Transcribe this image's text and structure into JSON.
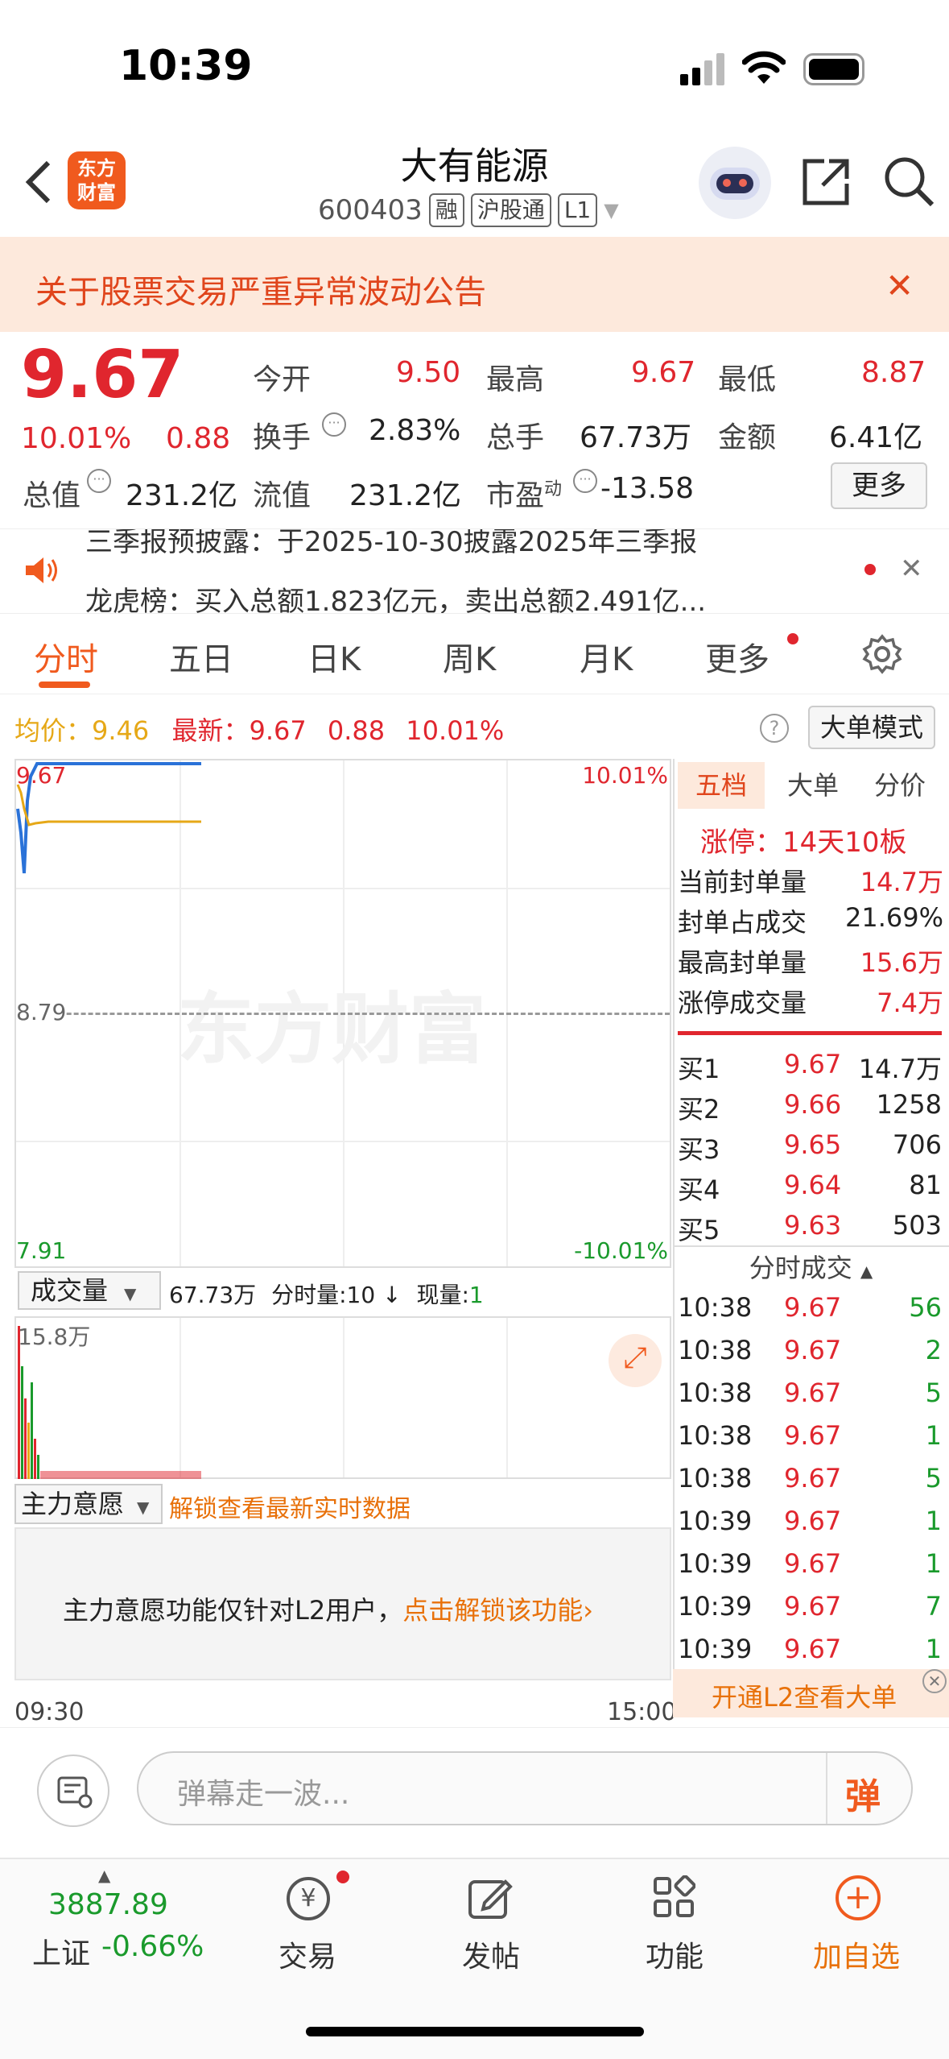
{
  "status": {
    "time": "10:39"
  },
  "header": {
    "title": "大有能源",
    "code": "600403",
    "tags": [
      "融",
      "沪股通",
      "L1"
    ],
    "logo_line1": "东方",
    "logo_line2": "财富"
  },
  "notice": {
    "text": "关于股票交易严重异常波动公告"
  },
  "quote": {
    "price": "9.67",
    "pct": "10.01%",
    "chg": "0.88",
    "open_label": "今开",
    "open": "9.50",
    "high_label": "最高",
    "high": "9.67",
    "low_label": "最低",
    "low": "8.87",
    "turnover_label": "换手",
    "turnover": "2.83%",
    "volume_label": "总手",
    "volume": "67.73万",
    "amount_label": "金额",
    "amount": "6.41亿",
    "mktcap_label": "总值",
    "mktcap": "231.2亿",
    "float_label": "流值",
    "float": "231.2亿",
    "pe_label": "市盈",
    "pe_sup": "动",
    "pe": "-13.58",
    "more_label": "更多"
  },
  "news": {
    "line1": "三季报预披露：于2025-10-30披露2025年三季报",
    "line2": "龙虎榜：买入总额1.823亿元，卖出总额2.491亿..."
  },
  "tabs": [
    "分时",
    "五日",
    "日K",
    "周K",
    "月K",
    "更多"
  ],
  "legend": {
    "avg_label": "均价：",
    "avg": "9.46",
    "last_label": "最新：",
    "last": "9.67",
    "chg": "0.88",
    "pct": "10.01%",
    "mode_button": "大单模式"
  },
  "chart": {
    "ymax": "9.67",
    "ymid": "8.79",
    "ymin": "7.91",
    "pct_max": "10.01%",
    "pct_min": "-10.01%",
    "watermark": "东方财富",
    "time_start": "09:30",
    "time_end": "15:00"
  },
  "volbar": {
    "selector": "成交量",
    "total": "67.73万",
    "tick_label": "分时量:",
    "tick": "10",
    "arrow": "↓",
    "now_label": "现量:",
    "now": "1",
    "max": "15.8万"
  },
  "fund": {
    "selector": "主力意愿",
    "unlock_link": "解锁查看最新实时数据",
    "msg": "主力意愿功能仅针对L2用户，",
    "msg_link": "点击解锁该功能"
  },
  "panel": {
    "tabs": [
      "五档",
      "大单",
      "分价"
    ],
    "limit": "涨停：14天10板",
    "stats": [
      {
        "label": "当前封单量",
        "value": "14.7万"
      },
      {
        "label": "封单占成交",
        "value": "21.69%"
      },
      {
        "label": "最高封单量",
        "value": "15.6万"
      },
      {
        "label": "涨停成交量",
        "value": "7.4万"
      }
    ],
    "bids": [
      {
        "label": "买1",
        "price": "9.67",
        "vol": "14.7万"
      },
      {
        "label": "买2",
        "price": "9.66",
        "vol": "1258"
      },
      {
        "label": "买3",
        "price": "9.65",
        "vol": "706"
      },
      {
        "label": "买4",
        "price": "9.64",
        "vol": "81"
      },
      {
        "label": "买5",
        "price": "9.63",
        "vol": "503"
      }
    ],
    "trades_title": "分时成交",
    "trades": [
      {
        "t": "10:38",
        "p": "9.67",
        "v": "56"
      },
      {
        "t": "10:38",
        "p": "9.67",
        "v": "2"
      },
      {
        "t": "10:38",
        "p": "9.67",
        "v": "5"
      },
      {
        "t": "10:38",
        "p": "9.67",
        "v": "1"
      },
      {
        "t": "10:38",
        "p": "9.67",
        "v": "5"
      },
      {
        "t": "10:39",
        "p": "9.67",
        "v": "1"
      },
      {
        "t": "10:39",
        "p": "9.67",
        "v": "1"
      },
      {
        "t": "10:39",
        "p": "9.67",
        "v": "7"
      },
      {
        "t": "10:39",
        "p": "9.67",
        "v": "1"
      }
    ],
    "l2_promo": "开通L2查看大单"
  },
  "comment": {
    "placeholder": "弹幕走一波...",
    "send": "弹"
  },
  "nav": {
    "index_value": "3887.89",
    "index_name": "上证",
    "index_pct": "-0.66%",
    "items": [
      "交易",
      "发帖",
      "功能",
      "加自选"
    ]
  }
}
